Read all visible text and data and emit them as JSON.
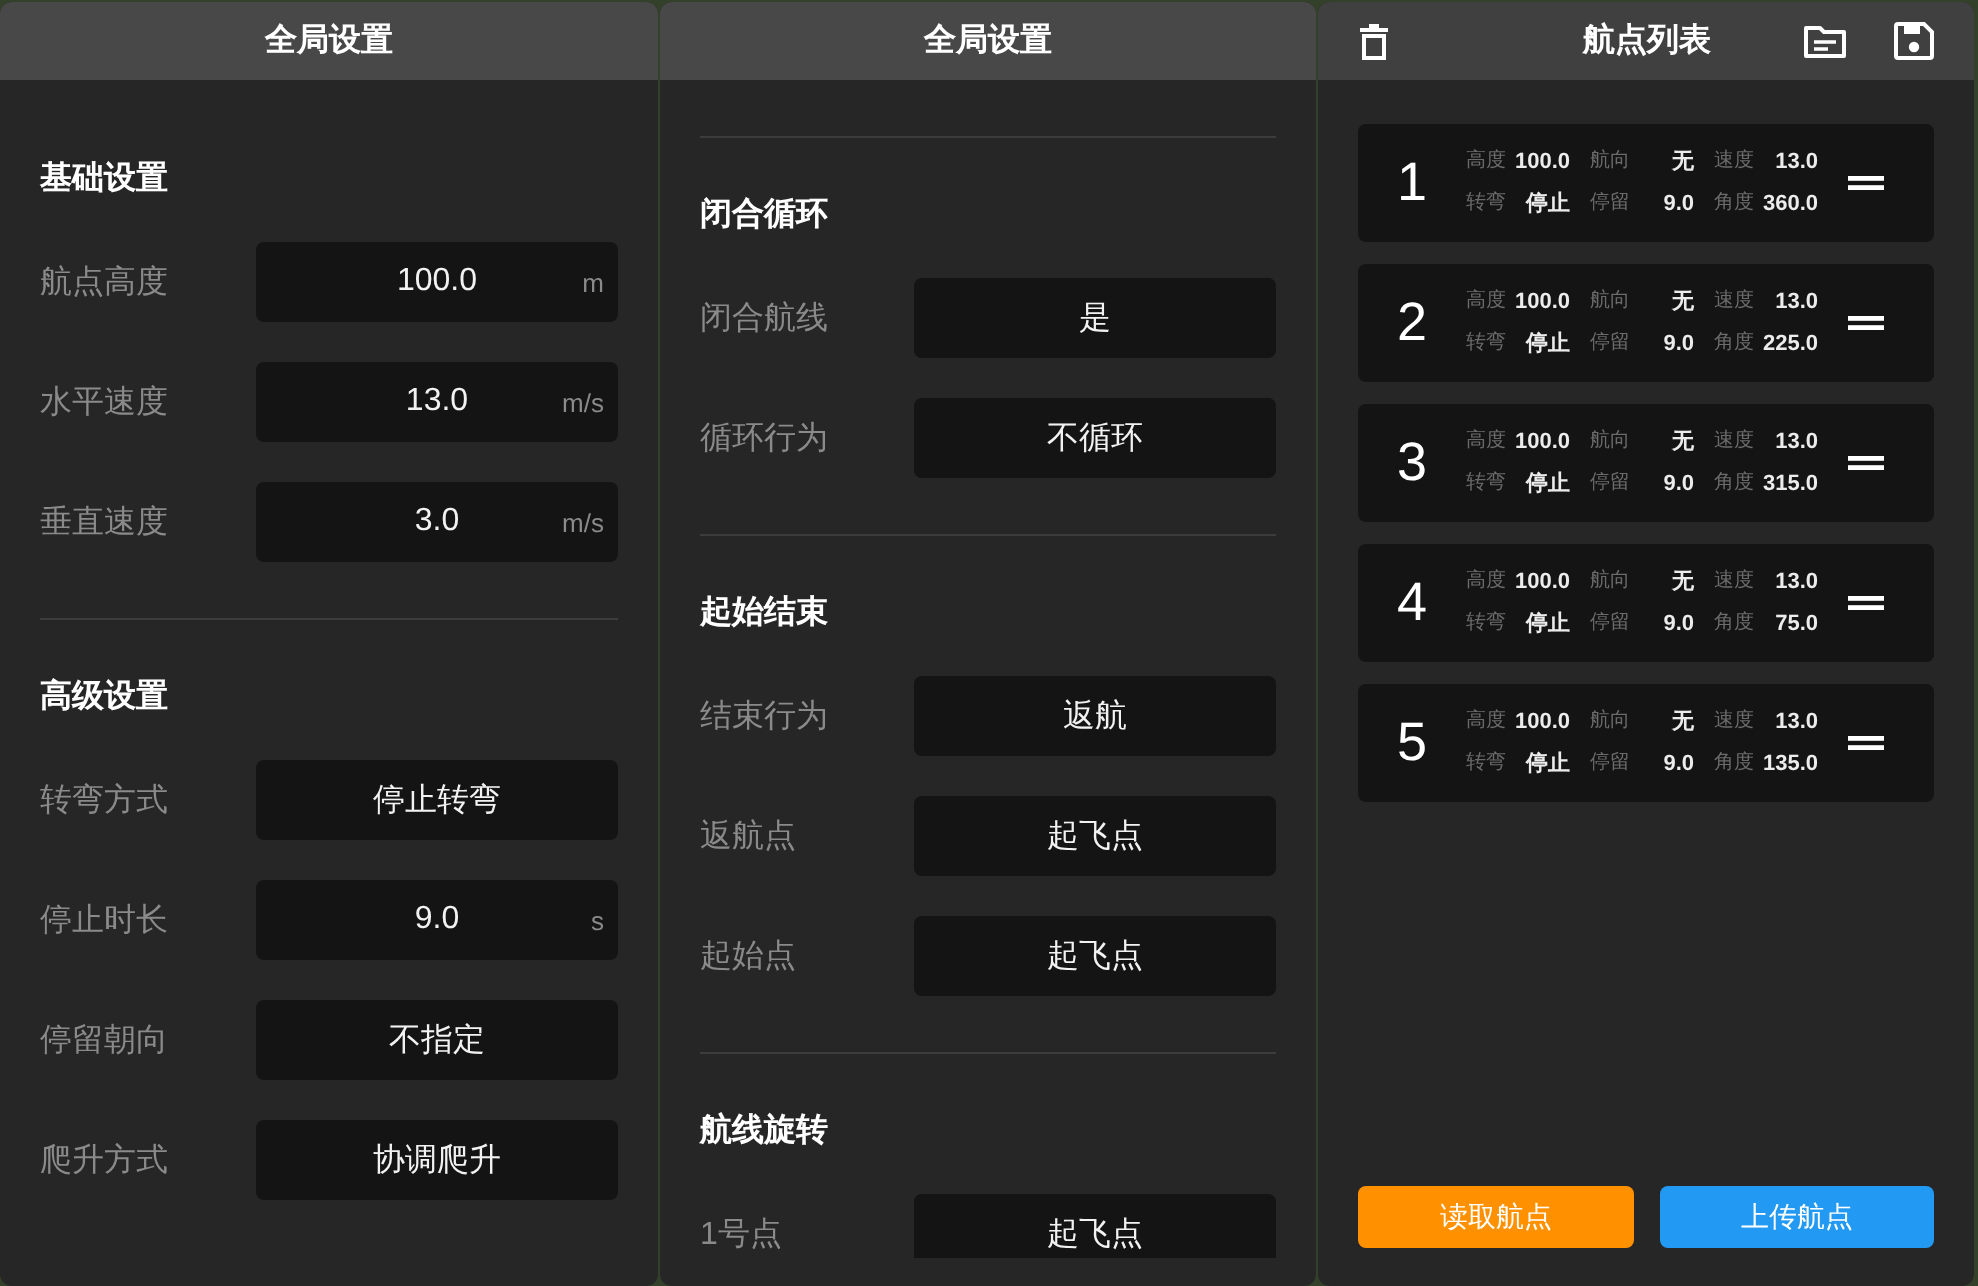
{
  "settings_panels": [
    {
      "title": "全局设置",
      "sections": [
        {
          "title": "基础设置",
          "rows": [
            {
              "label": "航点高度",
              "value": "100.0",
              "unit": "m"
            },
            {
              "label": "水平速度",
              "value": "13.0",
              "unit": "m/s"
            },
            {
              "label": "垂直速度",
              "value": "3.0",
              "unit": "m/s"
            }
          ]
        },
        {
          "title": "高级设置",
          "rows": [
            {
              "label": "转弯方式",
              "value": "停止转弯"
            },
            {
              "label": "停止时长",
              "value": "9.0",
              "unit": "s"
            },
            {
              "label": "停留朝向",
              "value": "不指定"
            },
            {
              "label": "爬升方式",
              "value": "协调爬升"
            }
          ]
        }
      ]
    },
    {
      "title": "全局设置",
      "sections": [
        {
          "title": "闭合循环",
          "rows": [
            {
              "label": "闭合航线",
              "value": "是"
            },
            {
              "label": "循环行为",
              "value": "不循环"
            }
          ]
        },
        {
          "title": "起始结束",
          "rows": [
            {
              "label": "结束行为",
              "value": "返航"
            },
            {
              "label": "返航点",
              "value": "起飞点"
            },
            {
              "label": "起始点",
              "value": "起飞点"
            }
          ]
        },
        {
          "title": "航线旋转",
          "rows": [
            {
              "label": "1号点",
              "value": "起飞点"
            }
          ]
        }
      ]
    }
  ],
  "waypoint_list": {
    "title": "航点列表",
    "waypoints": [
      {
        "number": "1",
        "fields": [
          {
            "label": "高度",
            "value": "100.0"
          },
          {
            "label": "航向",
            "value": "无"
          },
          {
            "label": "速度",
            "value": "13.0"
          },
          {
            "label": "转弯",
            "value": "停止"
          },
          {
            "label": "停留",
            "value": "9.0"
          },
          {
            "label": "角度",
            "value": "360.0"
          }
        ]
      },
      {
        "number": "2",
        "fields": [
          {
            "label": "高度",
            "value": "100.0"
          },
          {
            "label": "航向",
            "value": "无"
          },
          {
            "label": "速度",
            "value": "13.0"
          },
          {
            "label": "转弯",
            "value": "停止"
          },
          {
            "label": "停留",
            "value": "9.0"
          },
          {
            "label": "角度",
            "value": "225.0"
          }
        ]
      },
      {
        "number": "3",
        "fields": [
          {
            "label": "高度",
            "value": "100.0"
          },
          {
            "label": "航向",
            "value": "无"
          },
          {
            "label": "速度",
            "value": "13.0"
          },
          {
            "label": "转弯",
            "value": "停止"
          },
          {
            "label": "停留",
            "value": "9.0"
          },
          {
            "label": "角度",
            "value": "315.0"
          }
        ]
      },
      {
        "number": "4",
        "fields": [
          {
            "label": "高度",
            "value": "100.0"
          },
          {
            "label": "航向",
            "value": "无"
          },
          {
            "label": "速度",
            "value": "13.0"
          },
          {
            "label": "转弯",
            "value": "停止"
          },
          {
            "label": "停留",
            "value": "9.0"
          },
          {
            "label": "角度",
            "value": "75.0"
          }
        ]
      },
      {
        "number": "5",
        "fields": [
          {
            "label": "高度",
            "value": "100.0"
          },
          {
            "label": "航向",
            "value": "无"
          },
          {
            "label": "速度",
            "value": "13.0"
          },
          {
            "label": "转弯",
            "value": "停止"
          },
          {
            "label": "停留",
            "value": "9.0"
          },
          {
            "label": "角度",
            "value": "135.0"
          }
        ]
      }
    ],
    "buttons": [
      {
        "label": "读取航点",
        "color": "#ff9000"
      },
      {
        "label": "上传航点",
        "color": "#2299f2"
      }
    ]
  }
}
